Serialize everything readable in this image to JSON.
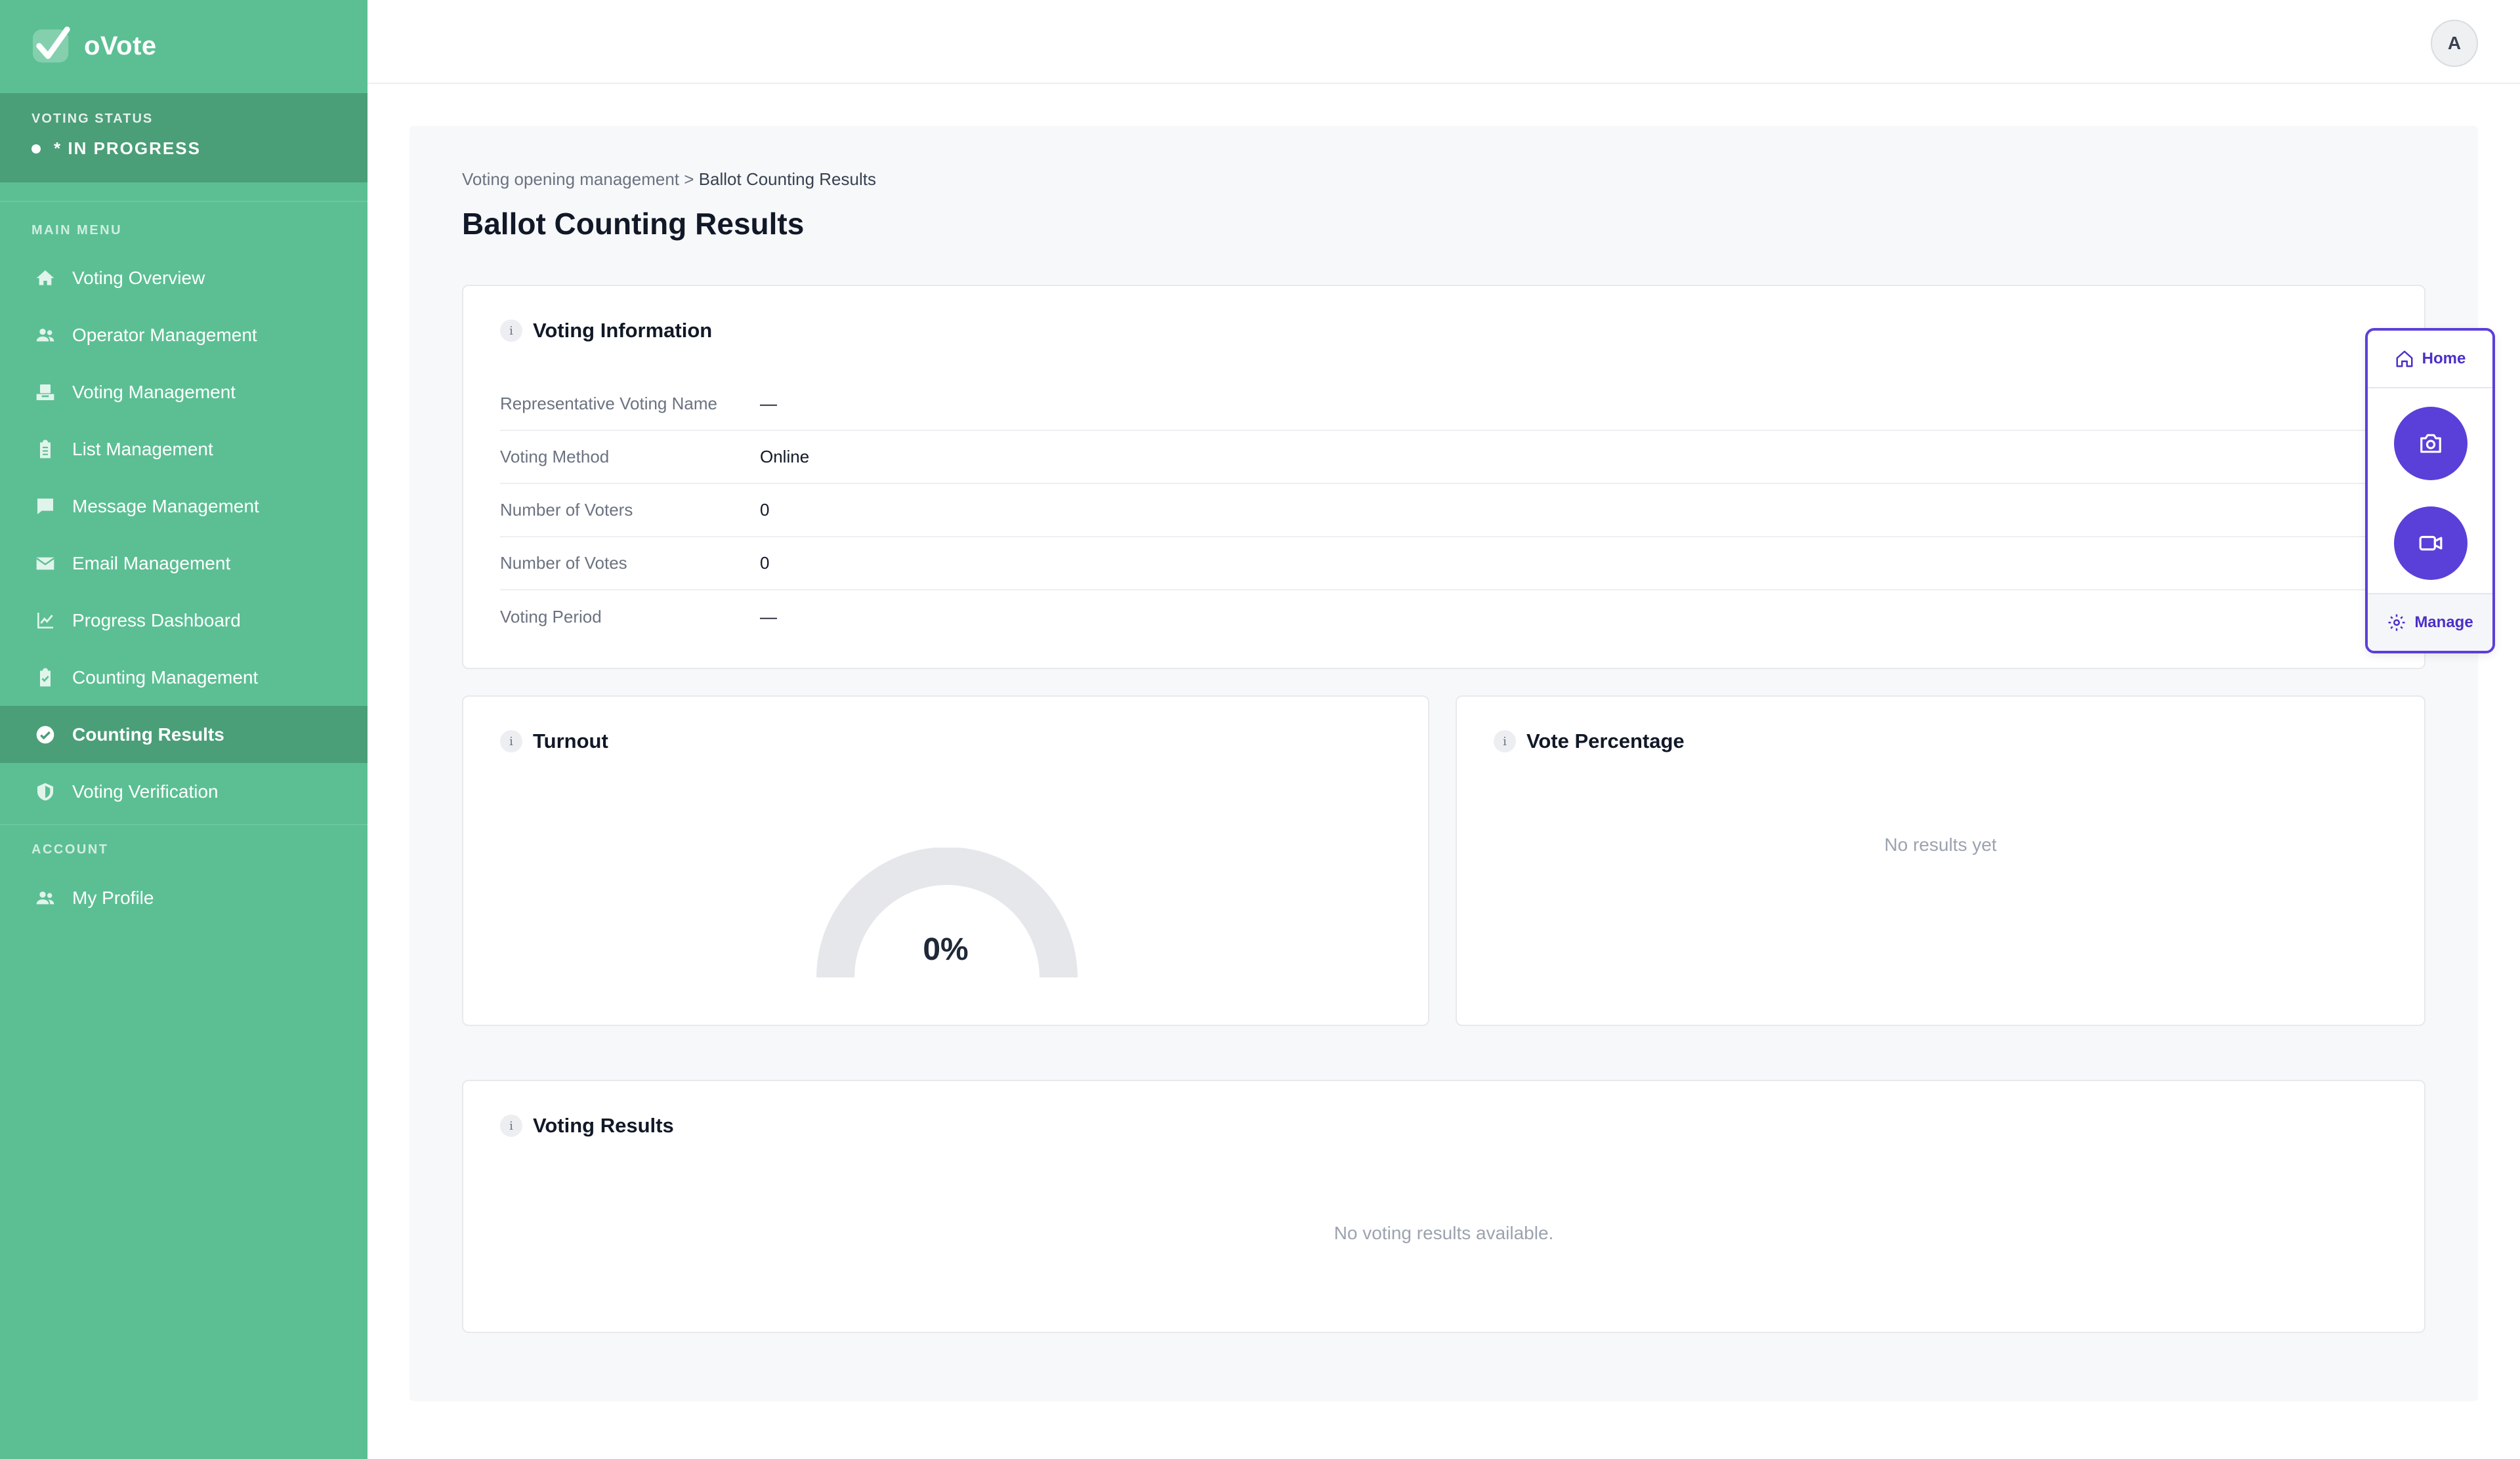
{
  "app": {
    "name": "oVote"
  },
  "status": {
    "label": "VOTING STATUS",
    "value": "* IN PROGRESS"
  },
  "sidebar": {
    "main_menu_label": "MAIN MENU",
    "items": [
      {
        "label": "Voting Overview",
        "icon": "home-icon"
      },
      {
        "label": "Operator Management",
        "icon": "users-icon"
      },
      {
        "label": "Voting Management",
        "icon": "ballot-box-icon"
      },
      {
        "label": "List Management",
        "icon": "clipboard-list-icon"
      },
      {
        "label": "Message Management",
        "icon": "chat-icon"
      },
      {
        "label": "Email Management",
        "icon": "envelope-icon"
      },
      {
        "label": "Progress Dashboard",
        "icon": "chart-line-icon"
      },
      {
        "label": "Counting Management",
        "icon": "clipboard-check-icon"
      },
      {
        "label": "Counting Results",
        "icon": "check-circle-icon",
        "active": true
      },
      {
        "label": "Voting Verification",
        "icon": "shield-icon"
      }
    ],
    "account_label": "ACCOUNT",
    "account_items": [
      {
        "label": "My Profile",
        "icon": "users-icon"
      }
    ]
  },
  "header": {
    "avatar_initial": "A"
  },
  "breadcrumb": {
    "parent": "Voting opening management",
    "separator": ">",
    "current": "Ballot Counting Results"
  },
  "page": {
    "title": "Ballot Counting Results"
  },
  "voting_information": {
    "title": "Voting Information",
    "rows": [
      {
        "label": "Representative Voting Name",
        "value": "—"
      },
      {
        "label": "Voting Method",
        "value": "Online"
      },
      {
        "label": "Number of Voters",
        "value": "0"
      },
      {
        "label": "Number of Votes",
        "value": "0"
      },
      {
        "label": "Voting Period",
        "value": "—"
      }
    ]
  },
  "turnout": {
    "title": "Turnout",
    "value_text": "0%",
    "fraction": 0
  },
  "vote_percentage": {
    "title": "Vote Percentage",
    "empty": "No results yet"
  },
  "voting_results": {
    "title": "Voting Results",
    "empty": "No voting results available."
  },
  "widget": {
    "home_label": "Home",
    "manage_label": "Manage"
  },
  "colors": {
    "sidebar": "#5bbf93",
    "sidebar_active": "#4a9e78",
    "accent": "#5b3fd9",
    "gauge_track": "#e5e7eb"
  }
}
